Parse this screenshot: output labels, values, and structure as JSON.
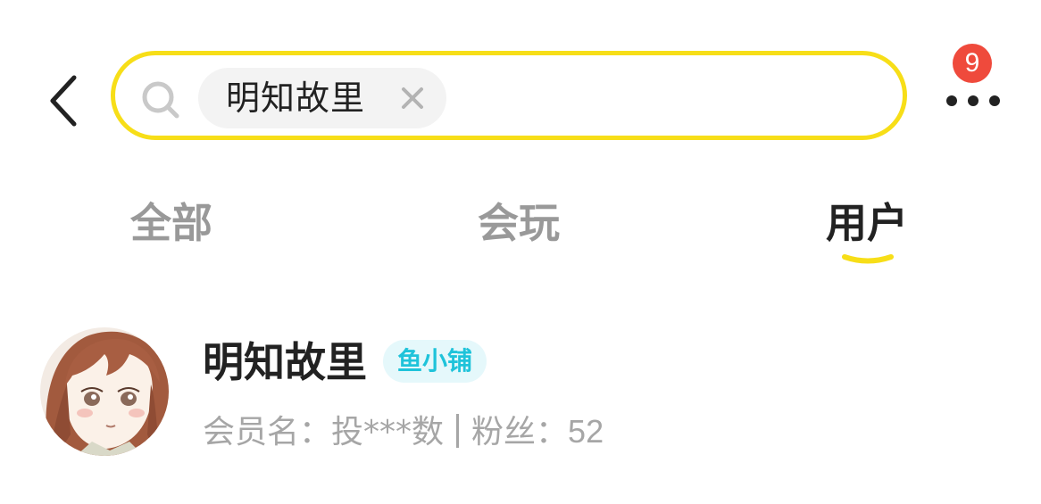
{
  "header": {
    "back_icon": "chevron-left-icon",
    "search": {
      "icon": "search-icon",
      "chip_text": "明知故里",
      "chip_close_icon": "close-icon"
    },
    "more_icon": "more-horizontal-icon",
    "badge_count": "9"
  },
  "tabs": [
    {
      "label": "全部",
      "active": false
    },
    {
      "label": "会玩",
      "active": false
    },
    {
      "label": "用户",
      "active": true
    }
  ],
  "results": [
    {
      "avatar": "avatar-anime-girl",
      "name": "明知故里",
      "badge": "鱼小铺",
      "member_label": "会员名：",
      "member_value": "投***数",
      "fans_label": "粉丝：",
      "fans_value": "52"
    }
  ],
  "colors": {
    "search_border": "#f7de18",
    "tab_underline": "#f7de18",
    "badge_bg": "#ef4a3c",
    "shop_badge_bg": "#e5f8fb",
    "shop_badge_text": "#1fc3da",
    "muted_text": "#a6a6a6"
  }
}
